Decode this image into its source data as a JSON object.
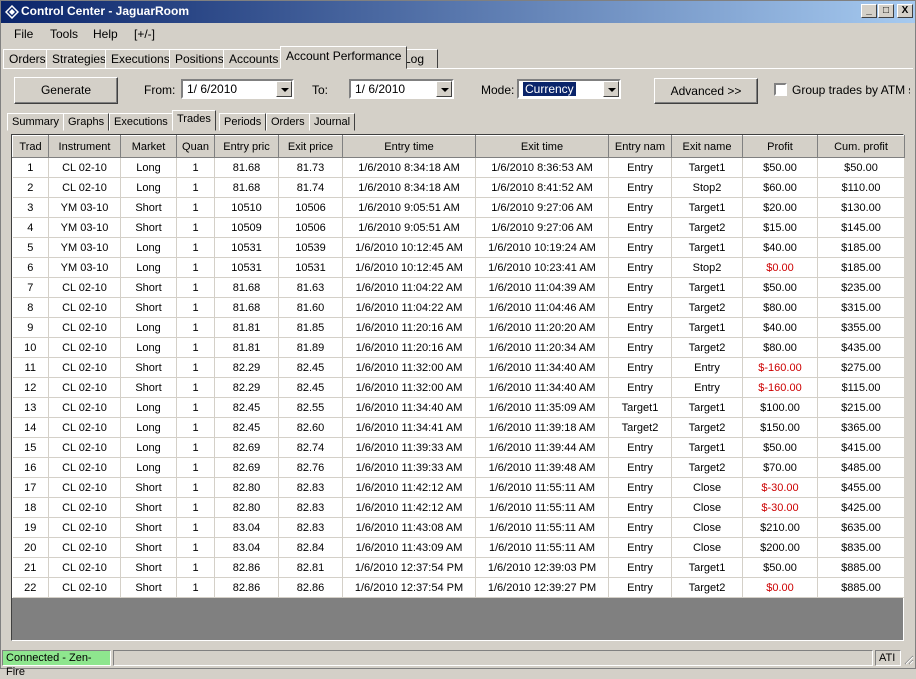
{
  "window": {
    "title": "Control Center - JaguarRoom",
    "minimize": "_",
    "maximize": "□",
    "close": "X"
  },
  "menu": [
    "File",
    "Tools",
    "Help",
    "[+/-]"
  ],
  "tabs_top": [
    "Orders",
    "Strategies",
    "Executions",
    "Positions",
    "Accounts",
    "Account Performance",
    "Log"
  ],
  "toolbar": {
    "generate": "Generate",
    "from_label": "From:",
    "from_value": "1/ 6/2010",
    "to_label": "To:",
    "to_value": "1/ 6/2010",
    "mode_label": "Mode:",
    "mode_value": "Currency",
    "advanced": "Advanced >>",
    "group_label": "Group trades by ATM stra"
  },
  "tabs_sub": [
    "Summary",
    "Graphs",
    "Executions",
    "Trades",
    "Periods",
    "Orders",
    "Journal"
  ],
  "table": {
    "columns": [
      "Trad",
      "Instrument",
      "Market",
      "Quan",
      "Entry pric",
      "Exit price",
      "Entry time",
      "Exit time",
      "Entry nam",
      "Exit name",
      "Profit",
      "Cum. profit"
    ],
    "rows": [
      [
        "1",
        "CL 02-10",
        "Long",
        "1",
        "81.68",
        "81.73",
        "1/6/2010 8:34:18 AM",
        "1/6/2010 8:36:53 AM",
        "Entry",
        "Target1",
        "$50.00",
        "$50.00"
      ],
      [
        "2",
        "CL 02-10",
        "Long",
        "1",
        "81.68",
        "81.74",
        "1/6/2010 8:34:18 AM",
        "1/6/2010 8:41:52 AM",
        "Entry",
        "Stop2",
        "$60.00",
        "$110.00"
      ],
      [
        "3",
        "YM 03-10",
        "Short",
        "1",
        "10510",
        "10506",
        "1/6/2010 9:05:51 AM",
        "1/6/2010 9:27:06 AM",
        "Entry",
        "Target1",
        "$20.00",
        "$130.00"
      ],
      [
        "4",
        "YM 03-10",
        "Short",
        "1",
        "10509",
        "10506",
        "1/6/2010 9:05:51 AM",
        "1/6/2010 9:27:06 AM",
        "Entry",
        "Target2",
        "$15.00",
        "$145.00"
      ],
      [
        "5",
        "YM 03-10",
        "Long",
        "1",
        "10531",
        "10539",
        "1/6/2010 10:12:45 AM",
        "1/6/2010 10:19:24 AM",
        "Entry",
        "Target1",
        "$40.00",
        "$185.00"
      ],
      [
        "6",
        "YM 03-10",
        "Long",
        "1",
        "10531",
        "10531",
        "1/6/2010 10:12:45 AM",
        "1/6/2010 10:23:41 AM",
        "Entry",
        "Stop2",
        "$0.00",
        "$185.00"
      ],
      [
        "7",
        "CL 02-10",
        "Short",
        "1",
        "81.68",
        "81.63",
        "1/6/2010 11:04:22 AM",
        "1/6/2010 11:04:39 AM",
        "Entry",
        "Target1",
        "$50.00",
        "$235.00"
      ],
      [
        "8",
        "CL 02-10",
        "Short",
        "1",
        "81.68",
        "81.60",
        "1/6/2010 11:04:22 AM",
        "1/6/2010 11:04:46 AM",
        "Entry",
        "Target2",
        "$80.00",
        "$315.00"
      ],
      [
        "9",
        "CL 02-10",
        "Long",
        "1",
        "81.81",
        "81.85",
        "1/6/2010 11:20:16 AM",
        "1/6/2010 11:20:20 AM",
        "Entry",
        "Target1",
        "$40.00",
        "$355.00"
      ],
      [
        "10",
        "CL 02-10",
        "Long",
        "1",
        "81.81",
        "81.89",
        "1/6/2010 11:20:16 AM",
        "1/6/2010 11:20:34 AM",
        "Entry",
        "Target2",
        "$80.00",
        "$435.00"
      ],
      [
        "11",
        "CL 02-10",
        "Short",
        "1",
        "82.29",
        "82.45",
        "1/6/2010 11:32:00 AM",
        "1/6/2010 11:34:40 AM",
        "Entry",
        "Entry",
        "$-160.00",
        "$275.00"
      ],
      [
        "12",
        "CL 02-10",
        "Short",
        "1",
        "82.29",
        "82.45",
        "1/6/2010 11:32:00 AM",
        "1/6/2010 11:34:40 AM",
        "Entry",
        "Entry",
        "$-160.00",
        "$115.00"
      ],
      [
        "13",
        "CL 02-10",
        "Long",
        "1",
        "82.45",
        "82.55",
        "1/6/2010 11:34:40 AM",
        "1/6/2010 11:35:09 AM",
        "Target1",
        "Target1",
        "$100.00",
        "$215.00"
      ],
      [
        "14",
        "CL 02-10",
        "Long",
        "1",
        "82.45",
        "82.60",
        "1/6/2010 11:34:41 AM",
        "1/6/2010 11:39:18 AM",
        "Target2",
        "Target2",
        "$150.00",
        "$365.00"
      ],
      [
        "15",
        "CL 02-10",
        "Long",
        "1",
        "82.69",
        "82.74",
        "1/6/2010 11:39:33 AM",
        "1/6/2010 11:39:44 AM",
        "Entry",
        "Target1",
        "$50.00",
        "$415.00"
      ],
      [
        "16",
        "CL 02-10",
        "Long",
        "1",
        "82.69",
        "82.76",
        "1/6/2010 11:39:33 AM",
        "1/6/2010 11:39:48 AM",
        "Entry",
        "Target2",
        "$70.00",
        "$485.00"
      ],
      [
        "17",
        "CL 02-10",
        "Short",
        "1",
        "82.80",
        "82.83",
        "1/6/2010 11:42:12 AM",
        "1/6/2010 11:55:11 AM",
        "Entry",
        "Close",
        "$-30.00",
        "$455.00"
      ],
      [
        "18",
        "CL 02-10",
        "Short",
        "1",
        "82.80",
        "82.83",
        "1/6/2010 11:42:12 AM",
        "1/6/2010 11:55:11 AM",
        "Entry",
        "Close",
        "$-30.00",
        "$425.00"
      ],
      [
        "19",
        "CL 02-10",
        "Short",
        "1",
        "83.04",
        "82.83",
        "1/6/2010 11:43:08 AM",
        "1/6/2010 11:55:11 AM",
        "Entry",
        "Close",
        "$210.00",
        "$635.00"
      ],
      [
        "20",
        "CL 02-10",
        "Short",
        "1",
        "83.04",
        "82.84",
        "1/6/2010 11:43:09 AM",
        "1/6/2010 11:55:11 AM",
        "Entry",
        "Close",
        "$200.00",
        "$835.00"
      ],
      [
        "21",
        "CL 02-10",
        "Short",
        "1",
        "82.86",
        "82.81",
        "1/6/2010 12:37:54 PM",
        "1/6/2010 12:39:03 PM",
        "Entry",
        "Target1",
        "$50.00",
        "$885.00"
      ],
      [
        "22",
        "CL 02-10",
        "Short",
        "1",
        "82.86",
        "82.86",
        "1/6/2010 12:37:54 PM",
        "1/6/2010 12:39:27 PM",
        "Entry",
        "Target2",
        "$0.00",
        "$885.00"
      ]
    ],
    "negative_profit_rows": [
      6,
      11,
      12,
      17,
      18,
      22
    ]
  },
  "status": {
    "connection": "Connected - Zen-Fire",
    "right": "ATI"
  },
  "colors": {
    "title_start": "#0a246a",
    "title_end": "#a6caf0",
    "negative": "#cc0000",
    "status_connected": "#8ee68e"
  }
}
